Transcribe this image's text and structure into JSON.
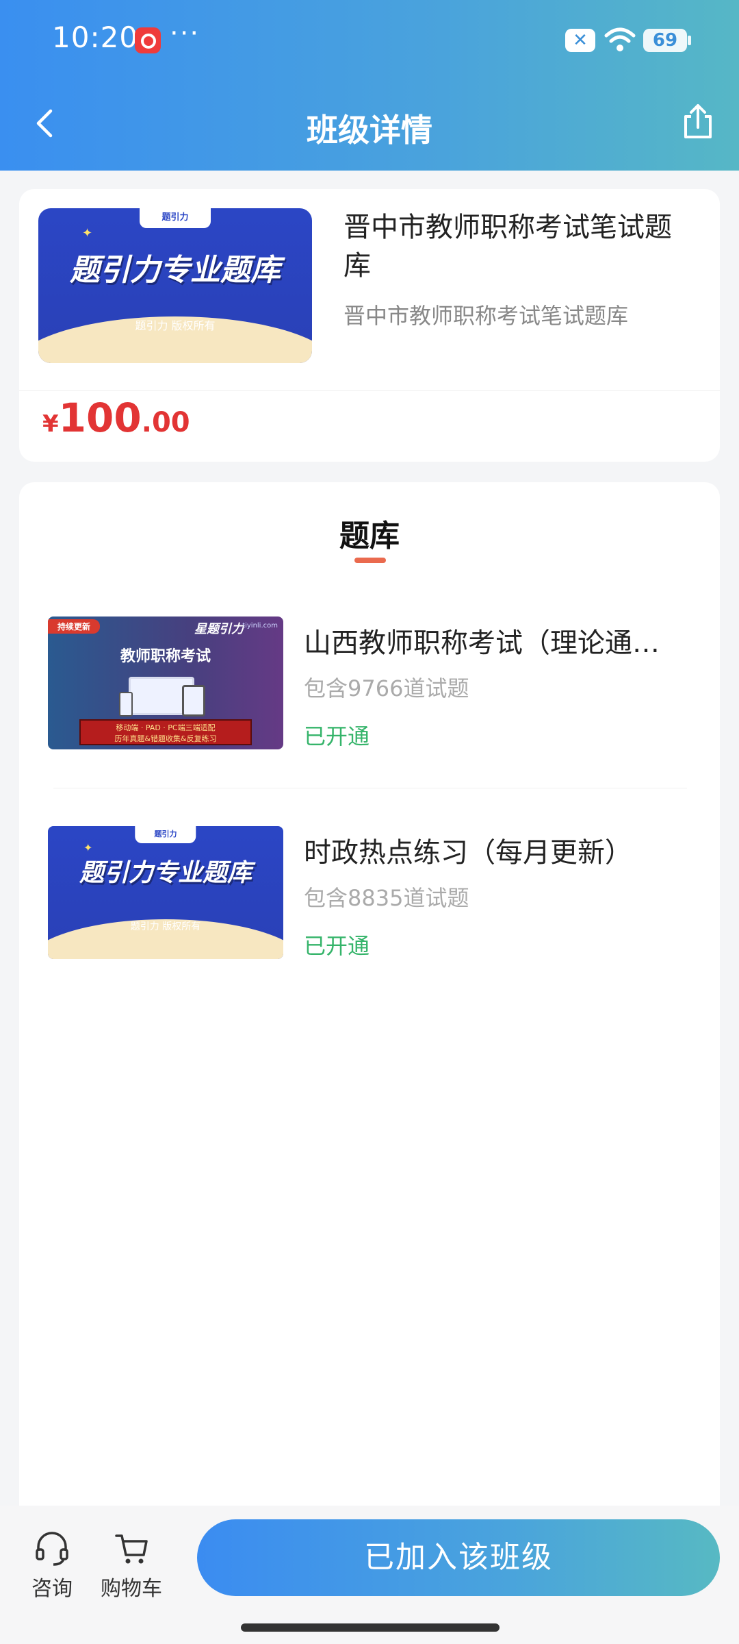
{
  "status_bar": {
    "time": "10:20",
    "more": "···",
    "battery": "69",
    "close_badge": "✕"
  },
  "nav": {
    "title": "班级详情"
  },
  "class_card": {
    "title": "晋中市教师职称考试笔试题库",
    "subtitle": "晋中市教师职称考试笔试题库",
    "price_symbol": "¥",
    "price_int": "100",
    "price_dec": ".00",
    "cover": {
      "tab_text": "题引力",
      "headline": "题引力专业题库",
      "copyright": "题引力 版权所有"
    }
  },
  "bank_section": {
    "title": "题库",
    "items": [
      {
        "title": "山西教师职称考试（理论通…",
        "count": "包含9766道试题",
        "status": "已开通",
        "cover": {
          "ribbon": "持续更新",
          "logo": "星题引力",
          "url": "tiyinli.com",
          "headline": "教师职称考试",
          "banner_line1": "移动端 · PAD · PC端三端适配",
          "banner_line2": "历年真题&错题收集&反复练习"
        }
      },
      {
        "title": "时政热点练习（每月更新）",
        "count": "包含8835道试题",
        "status": "已开通",
        "cover": {
          "tab_text": "题引力",
          "headline": "题引力专业题库",
          "copyright": "题引力 版权所有"
        }
      }
    ]
  },
  "bottom_bar": {
    "consult_label": "咨询",
    "cart_label": "购物车",
    "join_label": "已加入该班级"
  },
  "colors": {
    "accent_gradient_start": "#3a8ff0",
    "accent_gradient_end": "#56b7c6",
    "price": "#e23434",
    "status_open": "#35b46a",
    "underline": "#ea6a4e"
  }
}
